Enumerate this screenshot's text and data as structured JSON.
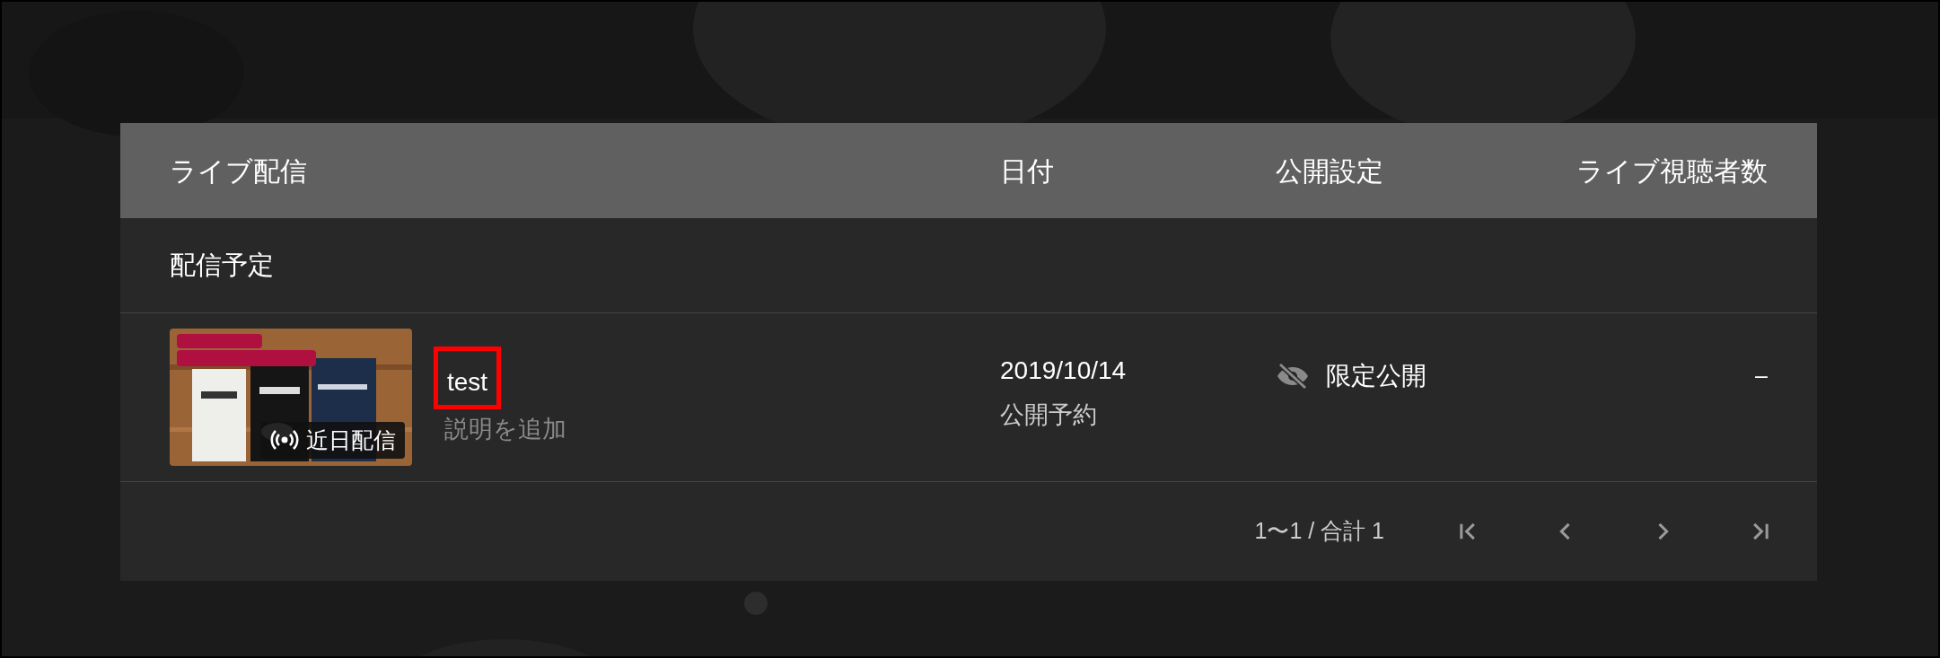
{
  "table": {
    "columns": [
      {
        "label": "ライブ配信"
      },
      {
        "label": "日付"
      },
      {
        "label": "公開設定"
      },
      {
        "label": "ライブ視聴者数"
      }
    ],
    "section": {
      "title": "配信予定"
    },
    "rows": [
      {
        "thumbnail": {
          "kind": "picture",
          "badge": "近日配信"
        },
        "title": "test",
        "highlighted": true,
        "description_placeholder": "説明を追加",
        "date": "2019/10/14",
        "date_status": "公開予約",
        "visibility": "限定公開",
        "viewers": "–"
      }
    ]
  },
  "pagination": {
    "range": "1〜1 / 合計 1"
  }
}
